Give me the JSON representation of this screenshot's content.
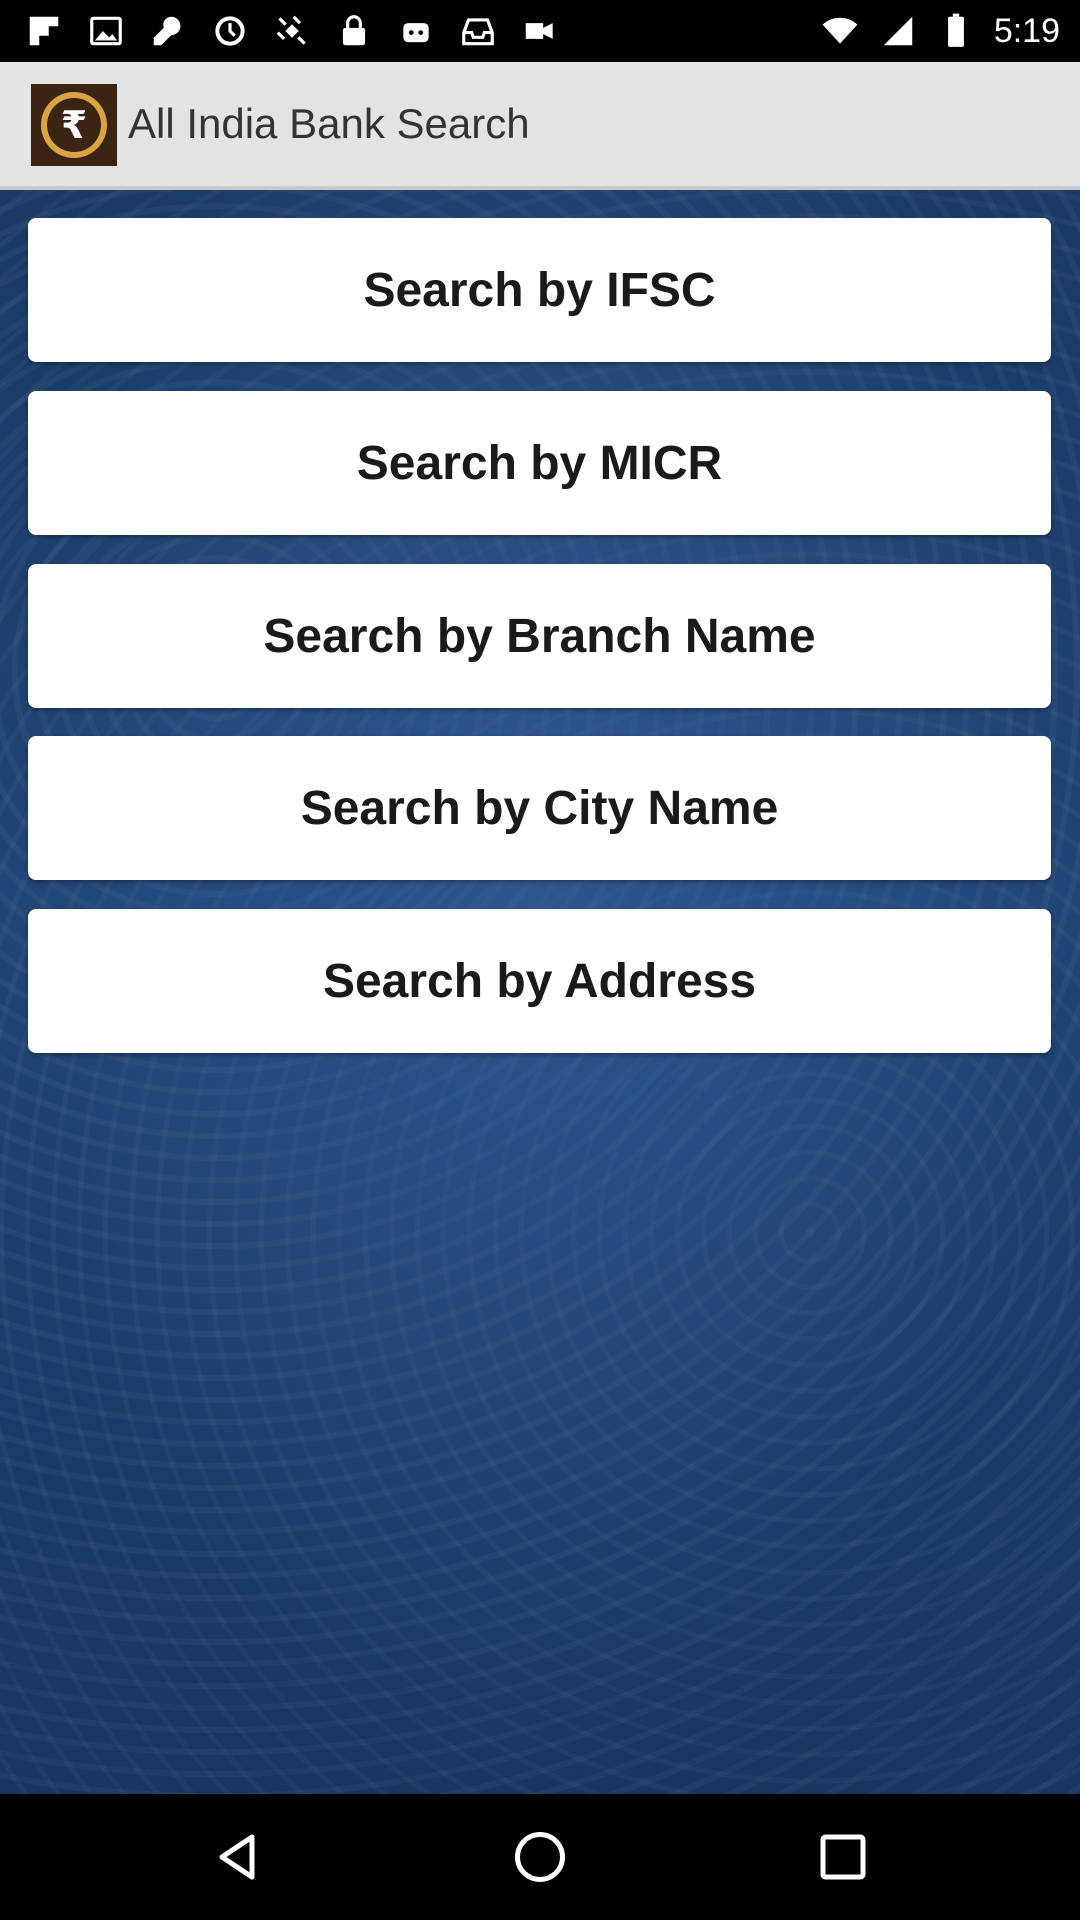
{
  "status_bar": {
    "time": "5:19",
    "icons_left": [
      "flipboard-icon",
      "image-icon",
      "wrench-icon",
      "settings-icon",
      "satellite-icon",
      "lock-icon",
      "robot-icon",
      "inbox-icon",
      "video-icon"
    ]
  },
  "app_bar": {
    "title": "All India Bank Search",
    "logo_icon": "rupee-coin-icon"
  },
  "menu": {
    "items": [
      {
        "label": "Search by IFSC"
      },
      {
        "label": "Search by MICR"
      },
      {
        "label": "Search by Branch Name"
      },
      {
        "label": "Search by City Name"
      },
      {
        "label": "Search by Address"
      }
    ]
  },
  "nav_bar": {
    "buttons": [
      "back-icon",
      "home-icon",
      "recents-icon"
    ]
  },
  "colors": {
    "app_bar_bg": "#e3e3e3",
    "content_bg": "#1f4677",
    "button_bg": "#ffffff",
    "logo_gold": "#d9a441"
  }
}
